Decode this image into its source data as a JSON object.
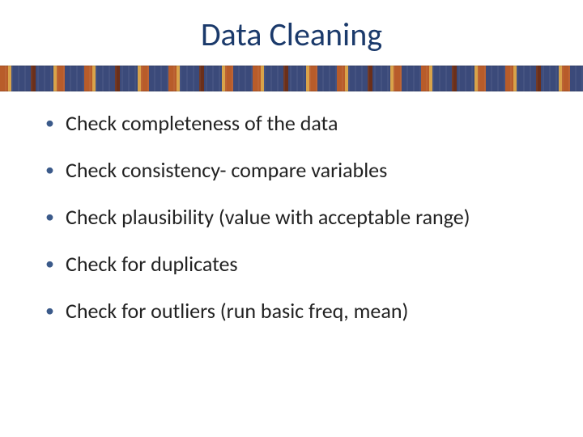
{
  "title": "Data Cleaning",
  "bullets": [
    "Check completeness of the data",
    "Check consistency- compare variables",
    "Check plausibility (value with acceptable range)",
    "Check for duplicates",
    "Check for outliers (run basic freq, mean)"
  ]
}
